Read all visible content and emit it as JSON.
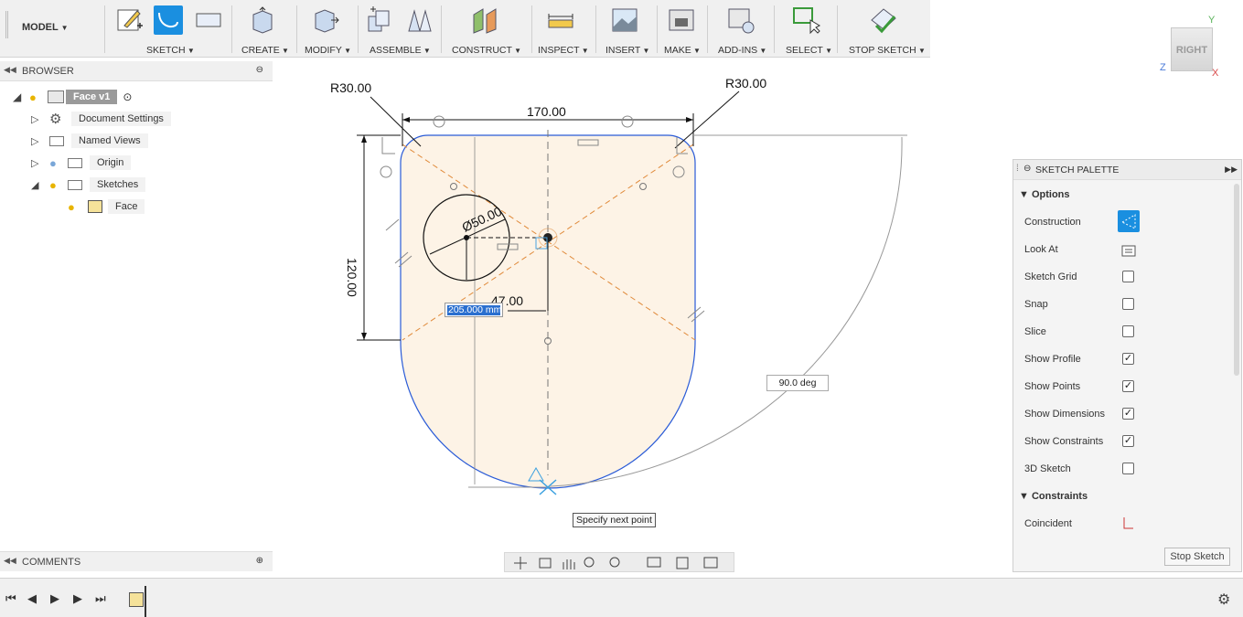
{
  "toolbar": {
    "workspace": "MODEL",
    "groups": [
      {
        "label": "SKETCH"
      },
      {
        "label": "CREATE"
      },
      {
        "label": "MODIFY"
      },
      {
        "label": "ASSEMBLE"
      },
      {
        "label": "CONSTRUCT"
      },
      {
        "label": "INSPECT"
      },
      {
        "label": "INSERT"
      },
      {
        "label": "MAKE"
      },
      {
        "label": "ADD-INS"
      },
      {
        "label": "SELECT"
      },
      {
        "label": "STOP SKETCH"
      }
    ]
  },
  "browser": {
    "title": "BROWSER",
    "items": [
      {
        "label": "Face v1"
      },
      {
        "label": "Document Settings"
      },
      {
        "label": "Named Views"
      },
      {
        "label": "Origin"
      },
      {
        "label": "Sketches"
      },
      {
        "label": "Face"
      }
    ]
  },
  "comments": {
    "title": "COMMENTS"
  },
  "sketch": {
    "radius_left": "R30.00",
    "radius_right": "R30.00",
    "width_dim": "170.00",
    "height_dim": "120.00",
    "diameter_dim": "Ø50.00",
    "offset_dim": "47.00",
    "length_input": "205.000 mm",
    "angle_input": "90.0 deg",
    "tooltip": "Specify next point"
  },
  "palette": {
    "title": "SKETCH PALETTE",
    "options_header": "Options",
    "rows": [
      {
        "label": "Construction"
      },
      {
        "label": "Look At"
      },
      {
        "label": "Sketch Grid",
        "checked": false
      },
      {
        "label": "Snap",
        "checked": false
      },
      {
        "label": "Slice",
        "checked": false
      },
      {
        "label": "Show Profile",
        "checked": true
      },
      {
        "label": "Show Points",
        "checked": true
      },
      {
        "label": "Show Dimensions",
        "checked": true
      },
      {
        "label": "Show Constraints",
        "checked": true
      },
      {
        "label": "3D Sketch",
        "checked": false
      }
    ],
    "constraints_header": "Constraints",
    "constraint_first": "Coincident",
    "stop_button": "Stop Sketch"
  },
  "viewcube": {
    "face": "RIGHT",
    "axis_y": "Y",
    "axis_z": "Z",
    "axis_x": "X"
  },
  "colors": {
    "accent": "#1a8fe0",
    "profile_fill": "#fdf3e6",
    "sketch_line": "#2a5bd7",
    "construction": "#e08a3a"
  }
}
